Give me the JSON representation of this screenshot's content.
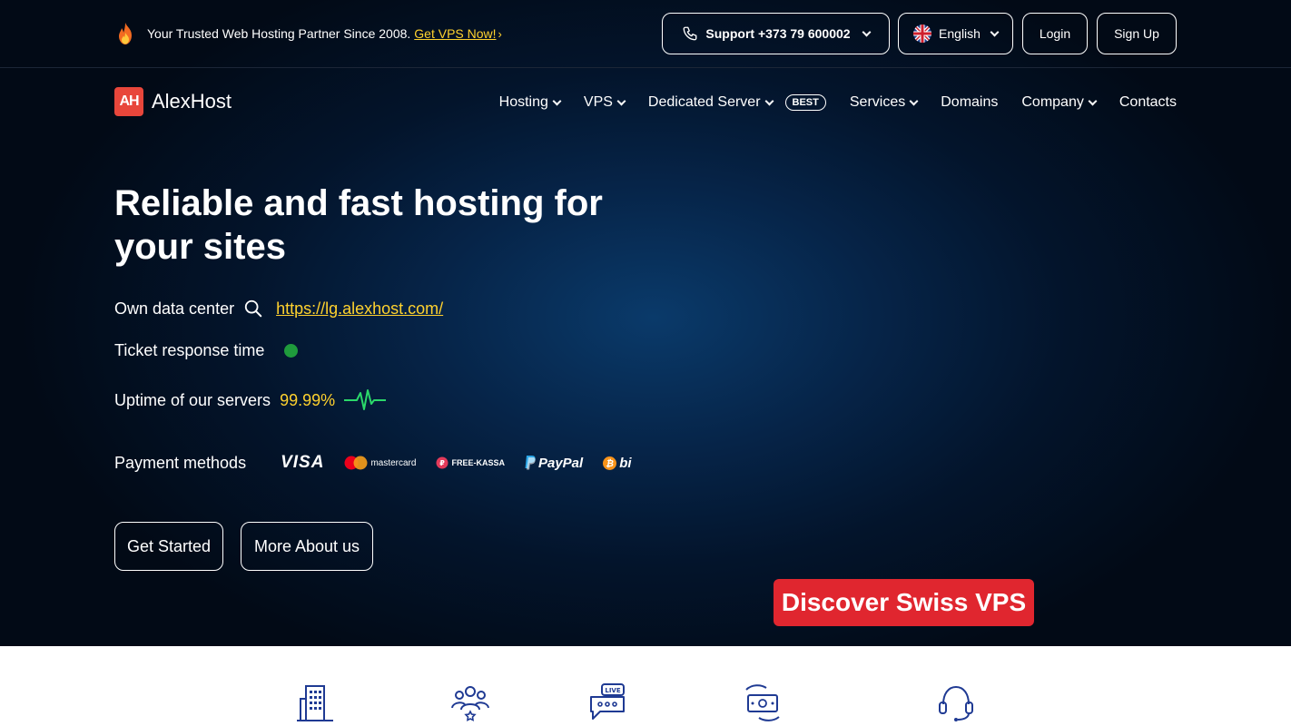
{
  "topbar": {
    "promo_text": "Your Trusted Web Hosting Partner Since 2008.",
    "promo_link": "Get VPS Now!",
    "promo_chevron": "›",
    "support_label": "Support +373 79 600002",
    "language_label": "English",
    "login_label": "Login",
    "signup_label": "Sign Up"
  },
  "brand": {
    "logo_mark": "AH",
    "name": "AlexHost"
  },
  "nav": {
    "hosting": "Hosting",
    "vps": "VPS",
    "dedicated": "Dedicated Server",
    "best_badge": "BEST",
    "services": "Services",
    "domains": "Domains",
    "company": "Company",
    "contacts": "Contacts"
  },
  "hero": {
    "title": "Reliable and fast hosting for your sites",
    "datacenter_label": "Own data center",
    "datacenter_link": "https://lg.alexhost.com/",
    "ticket_label": "Ticket response time",
    "uptime_label": "Uptime of our servers",
    "uptime_value": "99.99%",
    "payment_label": "Payment methods",
    "payments": {
      "visa": "VISA",
      "mastercard": "mastercard",
      "freekassa": "FREE-KASSA",
      "paypal": "PayPal",
      "bitcoin": "bi"
    },
    "get_started": "Get Started",
    "more_about": "More About us",
    "swiss_cta": "Discover Swiss VPS"
  },
  "features": {
    "icons": [
      "building-icon",
      "team-stars-icon",
      "live-chat-icon",
      "money-exchange-icon",
      "headset-icon"
    ]
  },
  "colors": {
    "accent_yellow": "#ffd22e",
    "brand_red": "#e8463b",
    "cta_red": "#e0262f",
    "status_green": "#1f9b3c",
    "hero_bg": "#03142b"
  }
}
